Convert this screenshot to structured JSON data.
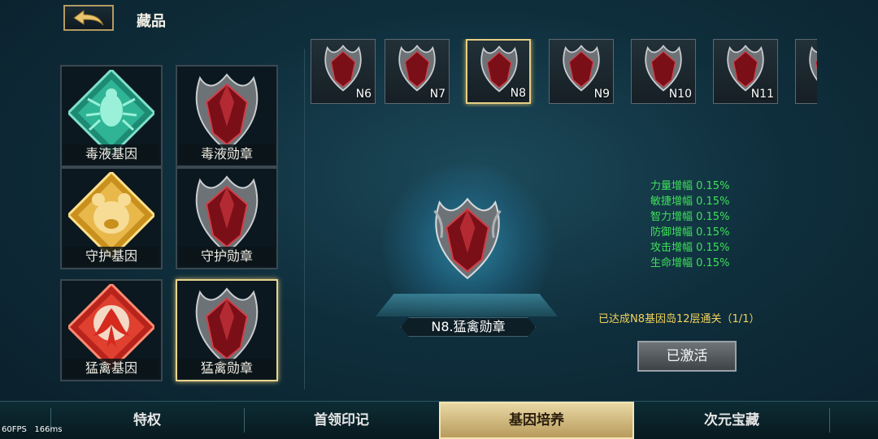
{
  "header": {
    "title": "藏品",
    "back_icon": "back-arrow-icon"
  },
  "collection_cards": [
    {
      "label": "毒液基因",
      "type": "gene",
      "color": "#2aa58c",
      "selected": false
    },
    {
      "label": "毒液勋章",
      "type": "medal",
      "color": "#8a1a22",
      "selected": false
    },
    {
      "label": "守护基因",
      "type": "gene",
      "color": "#e3b43a",
      "selected": false
    },
    {
      "label": "守护勋章",
      "type": "medal",
      "color": "#8a1a22",
      "selected": false
    },
    {
      "label": "猛禽基因",
      "type": "gene",
      "color": "#d8342a",
      "selected": false
    },
    {
      "label": "猛禽勋章",
      "type": "medal",
      "color": "#8a1a22",
      "selected": true
    }
  ],
  "medal_strip": [
    {
      "code": "N6",
      "selected": false
    },
    {
      "code": "N7",
      "selected": false
    },
    {
      "code": "N8",
      "selected": true
    },
    {
      "code": "N9",
      "selected": false
    },
    {
      "code": "N10",
      "selected": false
    },
    {
      "code": "N11",
      "selected": false
    },
    {
      "code": "",
      "selected": false
    }
  ],
  "showcase": {
    "name": "N8.猛禽勋章"
  },
  "stats": [
    "力量增幅 0.15%",
    "敏捷增幅 0.15%",
    "智力增幅 0.15%",
    "防御增幅 0.15%",
    "攻击增幅 0.15%",
    "生命增幅 0.15%"
  ],
  "requirement": "已达成N8基因岛12层通关（1/1）",
  "activate_button": "已激活",
  "tabs": [
    {
      "label": "特权",
      "selected": false
    },
    {
      "label": "首领印记",
      "selected": false
    },
    {
      "label": "基因培养",
      "selected": true
    },
    {
      "label": "次元宝藏",
      "selected": false
    }
  ],
  "debug": {
    "fps": "60FPS",
    "ms": "166ms"
  },
  "colors": {
    "accent_gold": "#e6cf84",
    "stat_green": "#3ee05a",
    "req_yellow": "#f2d35b"
  }
}
